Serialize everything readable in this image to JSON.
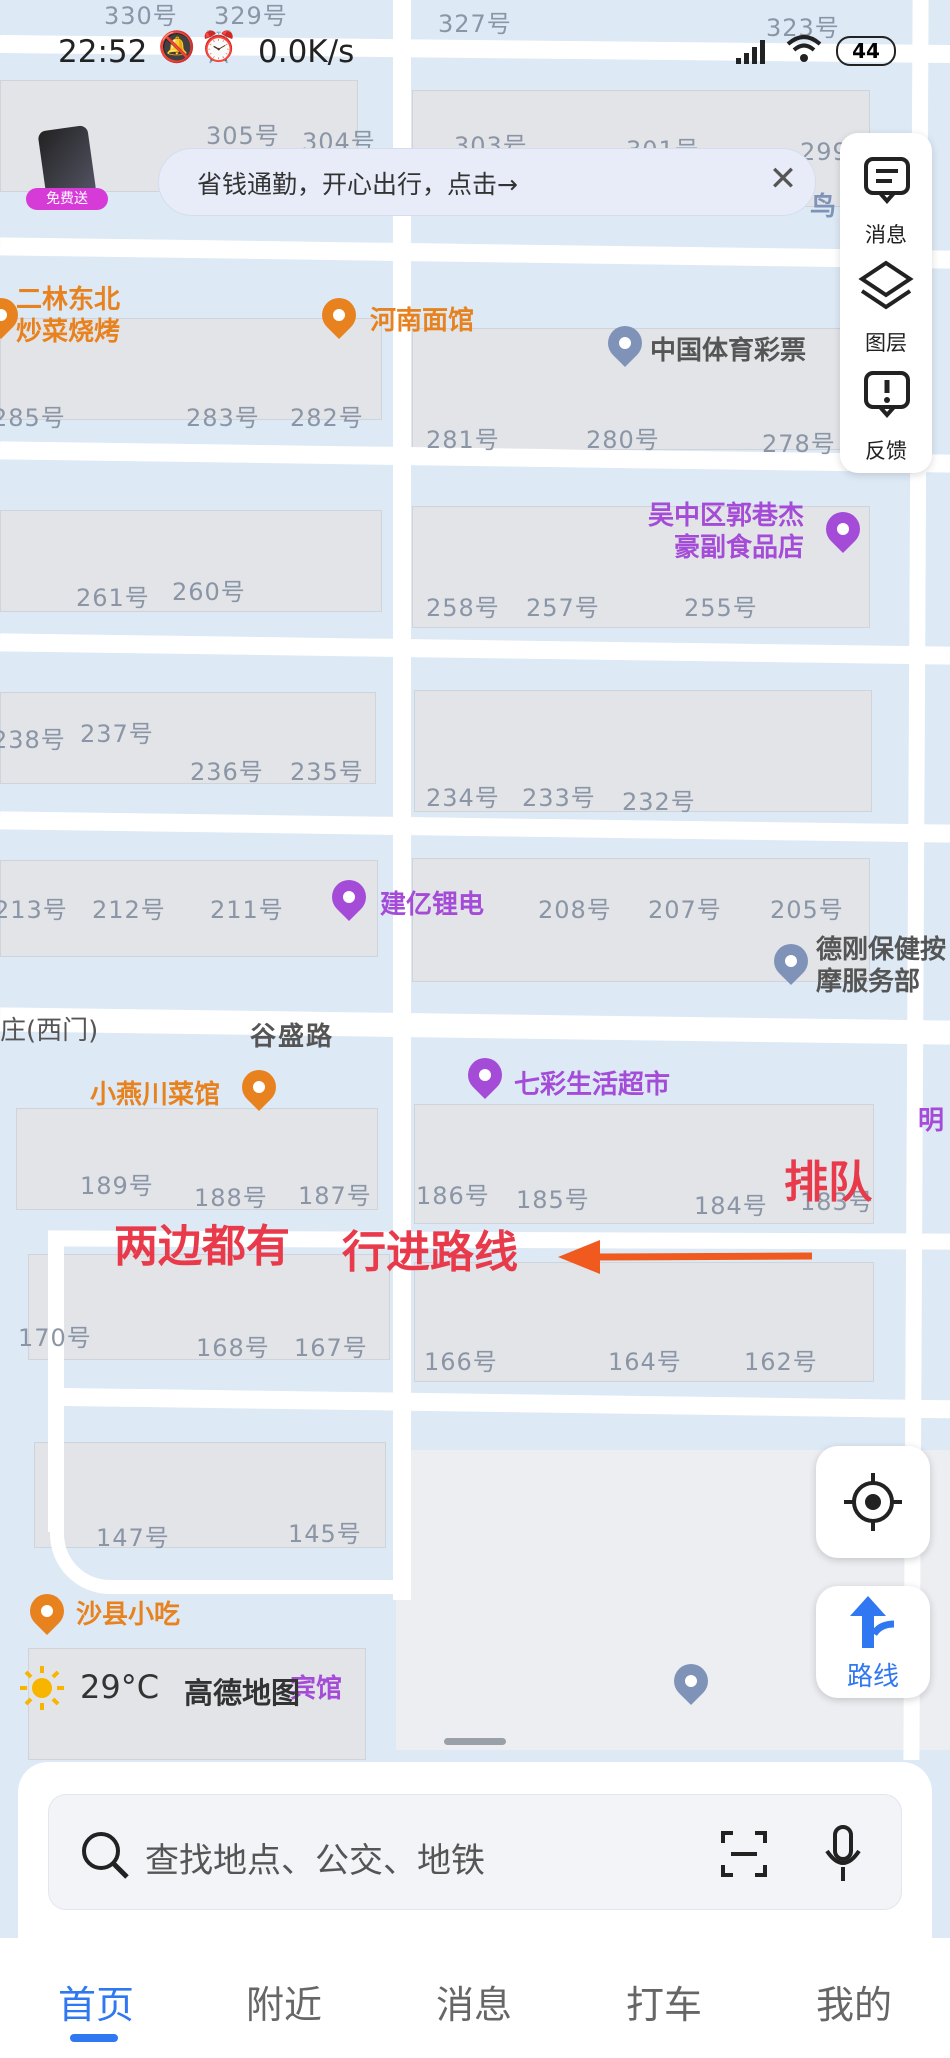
{
  "status": {
    "time": "22:52",
    "speed": "0.0K/s",
    "battery": "44"
  },
  "promo": {
    "badge": "免费送"
  },
  "banner": {
    "text": "省钱通勤，开心出行，点击→",
    "close": "✕"
  },
  "side_panel": {
    "items": [
      {
        "label": "消息",
        "icon": "message-icon"
      },
      {
        "label": "图层",
        "icon": "layers-icon"
      },
      {
        "label": "反馈",
        "icon": "feedback-icon"
      }
    ]
  },
  "map": {
    "house_numbers": [
      "330号",
      "329号",
      "327号",
      "323号",
      "305号",
      "304号",
      "303号",
      "301号",
      "299号",
      "285号",
      "283号",
      "282号",
      "281号",
      "280号",
      "278号",
      "261号",
      "260号",
      "258号",
      "257号",
      "255号",
      "238号",
      "237号",
      "236号",
      "235号",
      "234号",
      "233号",
      "232号",
      "213号",
      "212号",
      "211号",
      "208号",
      "207号",
      "205号",
      "189号",
      "188号",
      "187号",
      "186号",
      "185号",
      "184号",
      "183号",
      "170号",
      "168号",
      "167号",
      "166号",
      "164号",
      "162号",
      "147号",
      "145号"
    ],
    "pois": {
      "erlin": "二林东北\n炒菜烧烤",
      "henan": "河南面馆",
      "sports_lottery": "中国体育彩票",
      "wuzhong_food": "吴中区郭巷杰\n豪副食品店",
      "jianyi": "建亿锂电",
      "degang": "德刚保健按\n摩服务部",
      "west_gate": "庄(西门)",
      "road": "谷盛路",
      "qicai": "七彩生活超市",
      "xiaoyan": "小燕川菜馆",
      "ming": "明",
      "shaxian": "沙县小吃",
      "hotel_partial": "宾馆",
      "bird_partial": "鸟"
    },
    "annotations": {
      "queue": "排队",
      "both_sides": "两边都有",
      "route": "行进路线"
    },
    "colors": {
      "road_label": "#555555",
      "orange_poi": "#e8821e",
      "purple_poi": "#a44bd8",
      "blue_poi": "#7f93b8",
      "annotation": "#e83a4a",
      "arrow": "#f05a1e"
    }
  },
  "weather": {
    "temp": "29°C",
    "brand": "高德地图"
  },
  "route_button": {
    "label": "路线"
  },
  "search": {
    "placeholder": "查找地点、公交、地铁"
  },
  "tabs": [
    {
      "label": "首页",
      "active": true
    },
    {
      "label": "附近"
    },
    {
      "label": "消息"
    },
    {
      "label": "打车"
    },
    {
      "label": "我的"
    }
  ]
}
